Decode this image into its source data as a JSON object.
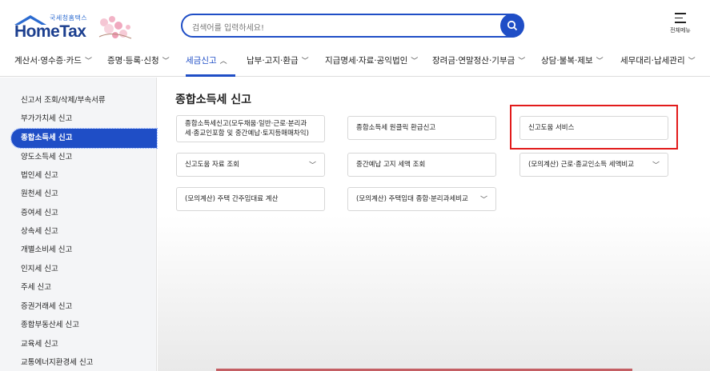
{
  "header": {
    "logo_sub": "국세청홈택스",
    "logo_name": "HomeTax",
    "search_placeholder": "검색어를 입력하세요!",
    "all_menu_label": "전체메뉴"
  },
  "nav": {
    "items": [
      {
        "label": "계산서·영수증·카드"
      },
      {
        "label": "증명·등록·신청"
      },
      {
        "label": "세금신고"
      },
      {
        "label": "납부·고지·환급"
      },
      {
        "label": "지급명세·자료·공익법인"
      },
      {
        "label": "장려금·연말정산·기부금"
      },
      {
        "label": "상담·불복·제보"
      },
      {
        "label": "세무대리·납세관리"
      }
    ]
  },
  "sidebar": {
    "items": [
      {
        "label": "신고서 조회/삭제/부속서류"
      },
      {
        "label": "부가가치세 신고"
      },
      {
        "label": "종합소득세 신고"
      },
      {
        "label": "양도소득세 신고"
      },
      {
        "label": "법인세 신고"
      },
      {
        "label": "원천세 신고"
      },
      {
        "label": "증여세 신고"
      },
      {
        "label": "상속세 신고"
      },
      {
        "label": "개별소비세 신고"
      },
      {
        "label": "인지세 신고"
      },
      {
        "label": "주세 신고"
      },
      {
        "label": "증권거래세 신고"
      },
      {
        "label": "종합부동산세 신고"
      },
      {
        "label": "교육세 신고"
      },
      {
        "label": "교통에너지환경세 신고"
      }
    ]
  },
  "main": {
    "title": "종합소득세 신고",
    "cards": [
      {
        "line1": "종합소득세신고(모두채움·일반·근로·분리과",
        "line2": "세·종교인포함 및 중간예납·토지등매매차익)"
      },
      {
        "line1": "종합소득세 원클릭 환급신고"
      },
      {
        "line1": "신고도움 서비스"
      },
      {
        "line1": "신고도움 자료 조회"
      },
      {
        "line1": "중간예납 고지 세액 조회"
      },
      {
        "line1": "(모의계산) 근로·종교인소득 세액비교"
      },
      {
        "line1": "(모의계산) 주택 간주임대료 계산"
      },
      {
        "line1": "(모의계산) 주택임대 종합·분리과세비교"
      }
    ]
  },
  "colors": {
    "accent": "#1f4ec6",
    "highlight": "#e21b1b",
    "sidebar_bg": "#f4f5f7"
  }
}
